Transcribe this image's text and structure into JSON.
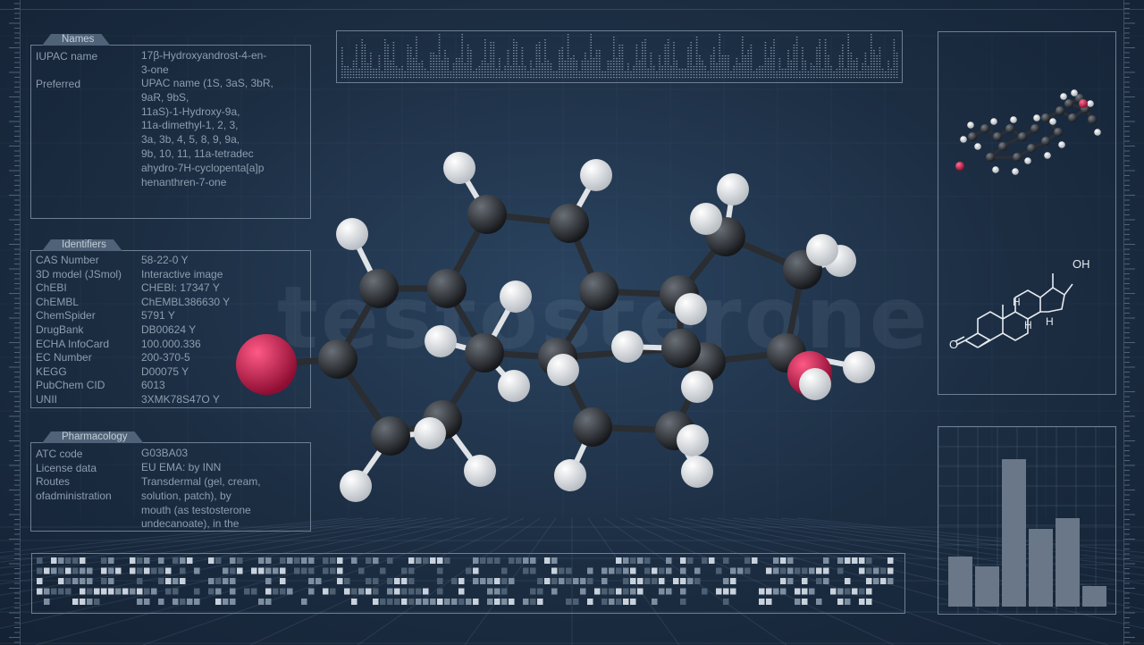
{
  "watermark": "testosterone",
  "names": {
    "title": "Names",
    "rows": [
      {
        "label": "IUPAC name",
        "value": "17β-Hydroxyandrost-4-en-\n3-one"
      },
      {
        "label": "Preferred",
        "value": "UPAC name (1S, 3aS, 3bR,\n9aR, 9bS,\n11aS)-1-Hydroxy-9a,\n11a-dimethyl-1, 2, 3,\n3a, 3b, 4, 5, 8, 9, 9a,\n9b, 10, 11, 11a-tetradec\nahydro-7H-cyclopenta[a]p\nhenanthren-7-one"
      }
    ]
  },
  "identifiers": {
    "title": "Identifiers",
    "rows": [
      {
        "label": "CAS Number",
        "value": "58-22-0 Y"
      },
      {
        "label": "3D model (JSmol)",
        "value": "Interactive image"
      },
      {
        "label": "ChEBI",
        "value": "CHEBI: 17347 Y"
      },
      {
        "label": "ChEMBL",
        "value": "ChEMBL386630 Y"
      },
      {
        "label": "ChemSpider",
        "value": "5791 Y"
      },
      {
        "label": "DrugBank",
        "value": "DB00624 Y"
      },
      {
        "label": "ECHA InfoCard",
        "value": "100.000.336"
      },
      {
        "label": "EC Number",
        "value": "200-370-5"
      },
      {
        "label": "KEGG",
        "value": "D00075 Y"
      },
      {
        "label": "PubChem CID",
        "value": "6013"
      },
      {
        "label": "UNII",
        "value": "3XMK78S47O Y"
      }
    ]
  },
  "pharmacology": {
    "title": "Pharmacology",
    "rows": [
      {
        "label": "ATC code",
        "value": "G03BA03"
      },
      {
        "label": "License data",
        "value": "EU EMA:  by INN"
      },
      {
        "label": "Routes\nofadministration",
        "value": "Transdermal (gel, cream,\nsolution, patch), by\nmouth (as testosterone\nundecanoate), in the"
      }
    ]
  },
  "structure_labels": {
    "oh": "OH",
    "o": "O",
    "h1": "H",
    "h2": "H",
    "h3": "H"
  },
  "bar_chart": {
    "values": [
      0.34,
      0.27,
      1.0,
      0.53,
      0.6,
      0.14
    ]
  },
  "colors": {
    "oxygen": "#d01a4c",
    "carbon": "#2d3034",
    "hydrogen": "#eef0f2",
    "panel_border": "#6d7f92"
  }
}
